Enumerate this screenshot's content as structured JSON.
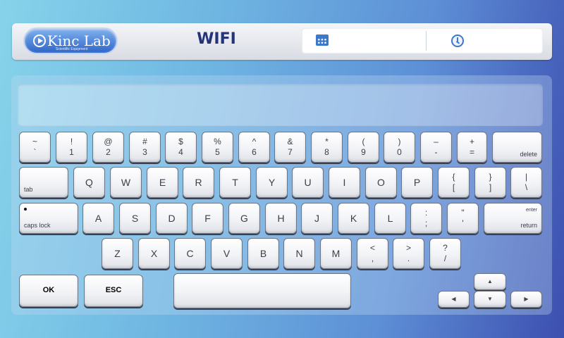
{
  "header": {
    "logo_text": "Kinc Lab",
    "logo_subtext": "Scientific Equipment",
    "title": "WIFI",
    "date_value": "",
    "time_value": ""
  },
  "input": {
    "value": ""
  },
  "keyboard": {
    "row1": [
      {
        "top": "~",
        "bot": "`"
      },
      {
        "top": "!",
        "bot": "1"
      },
      {
        "top": "@",
        "bot": "2"
      },
      {
        "top": "#",
        "bot": "3"
      },
      {
        "top": "$",
        "bot": "4"
      },
      {
        "top": "%",
        "bot": "5"
      },
      {
        "top": "^",
        "bot": "6"
      },
      {
        "top": "&",
        "bot": "7"
      },
      {
        "top": "*",
        "bot": "8"
      },
      {
        "top": "(",
        "bot": "9"
      },
      {
        "top": ")",
        "bot": "0"
      },
      {
        "top": "–",
        "bot": "-"
      },
      {
        "top": "+",
        "bot": "="
      }
    ],
    "delete_label": "delete",
    "tab_label": "tab",
    "row2": [
      "Q",
      "W",
      "E",
      "R",
      "T",
      "Y",
      "U",
      "I",
      "O",
      "P"
    ],
    "row2_sym": [
      {
        "top": "{",
        "bot": "["
      },
      {
        "top": "}",
        "bot": "]"
      },
      {
        "top": "|",
        "bot": "\\"
      }
    ],
    "caps_label": "caps lock",
    "row3": [
      "A",
      "S",
      "D",
      "F",
      "G",
      "H",
      "J",
      "K",
      "L"
    ],
    "row3_sym": [
      {
        "top": ":",
        "bot": ";"
      },
      {
        "top": "\"",
        "bot": "'"
      }
    ],
    "enter_label": "enter",
    "return_label": "return",
    "row4": [
      "Z",
      "X",
      "C",
      "V",
      "B",
      "N",
      "M"
    ],
    "row4_sym": [
      {
        "top": "<",
        "bot": ","
      },
      {
        "top": ">",
        "bot": "."
      },
      {
        "top": "?",
        "bot": "/"
      }
    ],
    "ok_label": "OK",
    "esc_label": "ESC",
    "arrows": {
      "up": "▲",
      "down": "▼",
      "left": "◀",
      "right": "▶"
    }
  }
}
